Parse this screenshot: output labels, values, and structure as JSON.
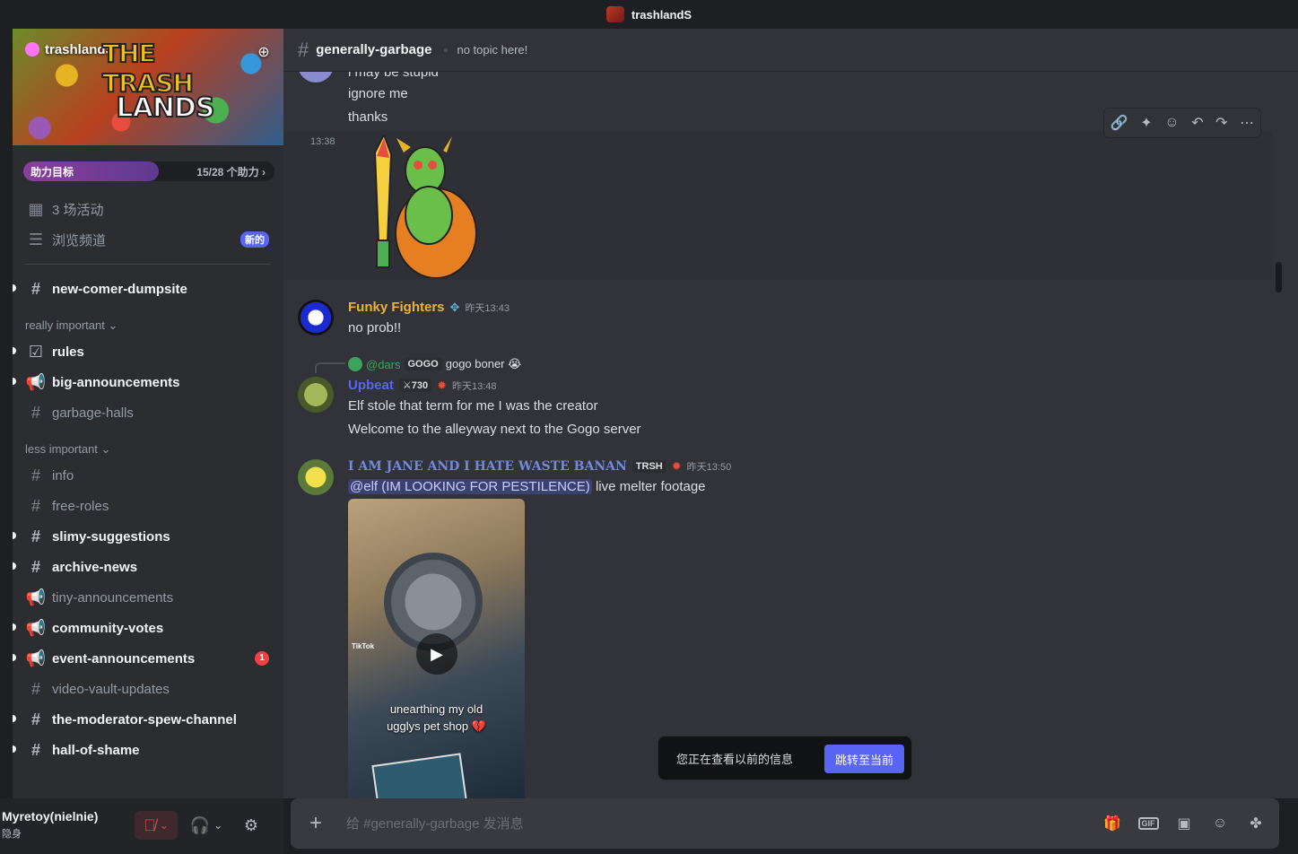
{
  "window": {
    "title": "trashlandS"
  },
  "server": {
    "name": "trashlandS",
    "banner_line1": "THE TRASH",
    "banner_line2": "LANDS",
    "boost_label": "助力目标",
    "boost_count": "15/28 个助力 ›",
    "boost_progress": 0.54
  },
  "sidebar": {
    "events": "3 场活动",
    "browse": "浏览频道",
    "browse_badge": "新的",
    "top_channel": "new-comer-dumpsite",
    "cat1": "really important ⌄",
    "cat1_items": [
      "rules",
      "big-announcements",
      "garbage-halls"
    ],
    "cat2": "less important ⌄",
    "cat2_items": [
      "info",
      "free-roles",
      "slimy-suggestions",
      "archive-news",
      "tiny-announcements",
      "community-votes",
      "event-announcements",
      "video-vault-updates",
      "the-moderator-spew-channel",
      "hall-of-shame"
    ],
    "event_ann_badge": "1"
  },
  "user": {
    "name": "Myretoy(nielnie)",
    "status": "隐身"
  },
  "channel": {
    "name": "generally-garbage",
    "topic": "no topic here!"
  },
  "messages": {
    "partial_line": "i may be stupid",
    "line1": "ignore me",
    "line2": "thanks",
    "sticker_time": "13:38",
    "m1": {
      "author": "Funky Fighters",
      "time": "昨天13:43",
      "text": "no prob!!"
    },
    "m2": {
      "reply_name": "@dars",
      "reply_tag": "GOGO",
      "reply_text": "gogo boner 😭",
      "author": "Upbeat",
      "tag": "⚔730",
      "time": "昨天13:48",
      "line1": "Elf stole that term for me I was the creator",
      "line2": "Welcome to the alleyway next to the Gogo server"
    },
    "m3": {
      "author": "I AM JANE AND I HATE WASTE BANAN",
      "tag": "TRSH",
      "time": "昨天13:50",
      "mention": "@elf (IM LOOKING FOR PESTILENCE)",
      "text": " live melter footage",
      "video_watermark": "TikTok",
      "video_caption_1": "unearthing my old",
      "video_caption_2": "ugglys pet shop 💔"
    }
  },
  "jump_bar": {
    "text": "您正在查看以前的信息",
    "button": "跳转至当前"
  },
  "composer": {
    "placeholder": "给 #generally-garbage 发消息"
  },
  "colors": {
    "accent": "#5865f2",
    "funky": "#f0b232",
    "upbeat": "#5865f2",
    "jane": "#7289da"
  }
}
